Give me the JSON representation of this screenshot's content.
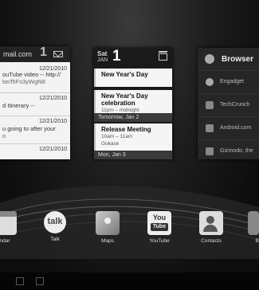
{
  "gmail": {
    "account": "mail.com",
    "unread_count": "1",
    "messages": [
      {
        "date": "12/21/2010",
        "line1": "ouTube video -- http://",
        "line2": "be/f5Fs3yWgN8"
      },
      {
        "date": "12/21/2010",
        "line1": "d Itinerary --",
        "line2": ""
      },
      {
        "date": "12/21/2010",
        "line1": "u going to after your",
        "line2": "o"
      },
      {
        "date": "12/21/2010",
        "line1": "",
        "line2": ""
      }
    ]
  },
  "calendar": {
    "dow": "Sat",
    "month": "JAN",
    "day": "1",
    "events": [
      {
        "title": "New Year's Day",
        "meta": "",
        "location": ""
      },
      {
        "title": "New Year's Day celebration",
        "meta": "11pm – midnight",
        "location": ""
      },
      {
        "title": "Release Meeting",
        "meta": "10am – 11am",
        "location": "Gokase"
      }
    ],
    "separators": [
      "Tomorrow, Jan 2",
      "Mon, Jan 3"
    ]
  },
  "browser": {
    "title": "Browser",
    "bookmarks": [
      {
        "label": "Engadget",
        "icon": "engadget-icon"
      },
      {
        "label": "TechCrunch",
        "icon": "techcrunch-icon"
      },
      {
        "label": "Android.com",
        "icon": "android-icon"
      },
      {
        "label": "Gizmodo, the",
        "icon": "gizmodo-icon"
      }
    ]
  },
  "dock": [
    {
      "label": "ndar",
      "icon": "calendar-icon"
    },
    {
      "label": "Talk",
      "icon": "talk-icon"
    },
    {
      "label": "Maps",
      "icon": "maps-icon"
    },
    {
      "label": "YouTube",
      "icon": "youtube-icon"
    },
    {
      "label": "Contacts",
      "icon": "contacts-icon"
    },
    {
      "label": "B",
      "icon": "app-icon"
    }
  ],
  "icon_text": {
    "talk": "talk",
    "you": "You",
    "tube": "Tube"
  }
}
